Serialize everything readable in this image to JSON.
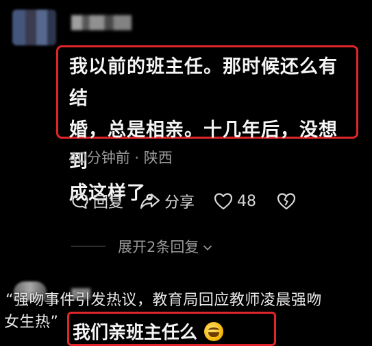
{
  "comment": {
    "text_lines": [
      "我以前的班主任。那时候还么有结",
      "婚，总是相亲。十几年后，没想到",
      "成这样了。"
    ],
    "meta": "40分钟前 · 陕西"
  },
  "actions": {
    "reply_label": "回复",
    "share_label": "分享",
    "like_count": "48"
  },
  "expand": {
    "label": "展开2条回复"
  },
  "caption": {
    "line1": "“强吻事件引发热议，教育局回应教师凌晨强吻",
    "line2": "女生热”"
  },
  "reply": {
    "text": "我们亲班主任么"
  },
  "colors": {
    "highlight_border": "#e0262b",
    "meta_text": "#9a9a9a",
    "background": "#000000"
  },
  "icons": [
    "reply-icon",
    "share-icon",
    "heart-icon",
    "broken-heart-icon",
    "chevron-down-icon",
    "laughing-emoji-icon"
  ]
}
